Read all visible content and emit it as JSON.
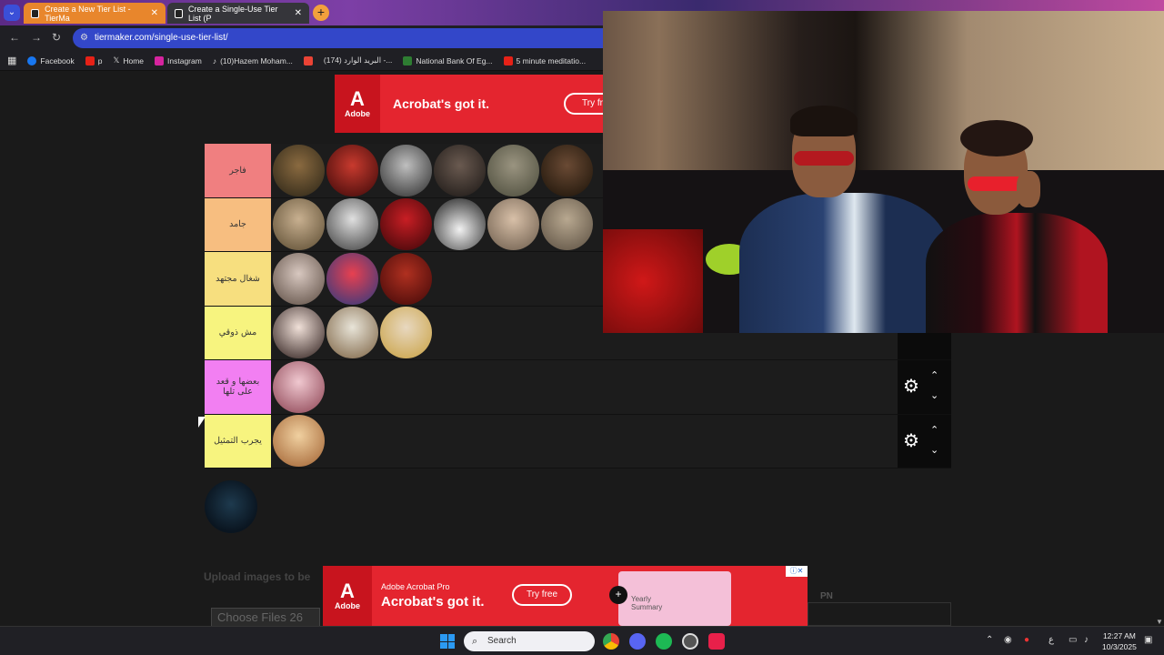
{
  "browser": {
    "tabs": [
      {
        "title": "Create a New Tier List - TierMa",
        "active": false
      },
      {
        "title": "Create a Single-Use Tier List (P",
        "active": true
      }
    ],
    "url": "tiermaker.com/single-use-tier-list/",
    "bookmarks": [
      {
        "label": "Facebook",
        "icon": "facebook-icon"
      },
      {
        "label": "p",
        "icon": "youtube-icon"
      },
      {
        "label": "Home",
        "icon": "x-icon"
      },
      {
        "label": "Instagram",
        "icon": "instagram-icon"
      },
      {
        "label": "(10)Hazem Moham...",
        "icon": "tiktok-icon"
      },
      {
        "label": "",
        "icon": "gmail-icon"
      },
      {
        "label": "(174) البريد الوارد -...",
        "icon": "mail-icon"
      },
      {
        "label": "National Bank Of Eg...",
        "icon": "bank-icon"
      },
      {
        "label": "5 minute meditatio...",
        "icon": "youtube-icon"
      }
    ]
  },
  "ads": {
    "top": {
      "brand": "Adobe",
      "headline": "Acrobat's got it.",
      "cta": "Try fr"
    },
    "bottom": {
      "brand": "Adobe",
      "product": "Adobe Acrobat Pro",
      "headline": "Acrobat's got it.",
      "cta": "Try free",
      "preview_text": "Yearly Summary"
    }
  },
  "tiers": [
    {
      "label": "فاجر",
      "color": "#f07f80",
      "items": 7
    },
    {
      "label": "جامد",
      "color": "#f7be80",
      "items": 6
    },
    {
      "label": "شغال مجتهد",
      "color": "#f7df7f",
      "items": 3
    },
    {
      "label": "مش ذوقي",
      "color": "#f7f47f",
      "items": 3
    },
    {
      "label": "بعضها و قعد على تلها",
      "color": "#f27ff2",
      "items": 1
    },
    {
      "label": "يجرب التمثيل",
      "color": "#f7f47f",
      "items": 1
    }
  ],
  "page": {
    "upload_label": "Upload images to be",
    "choose_files": "Choose Files",
    "choose_files_count": "26",
    "pn_label": "PN"
  },
  "taskbar": {
    "search_placeholder": "Search",
    "lang": "ع",
    "time": "12:27 AM",
    "date": "10/3/2025"
  }
}
